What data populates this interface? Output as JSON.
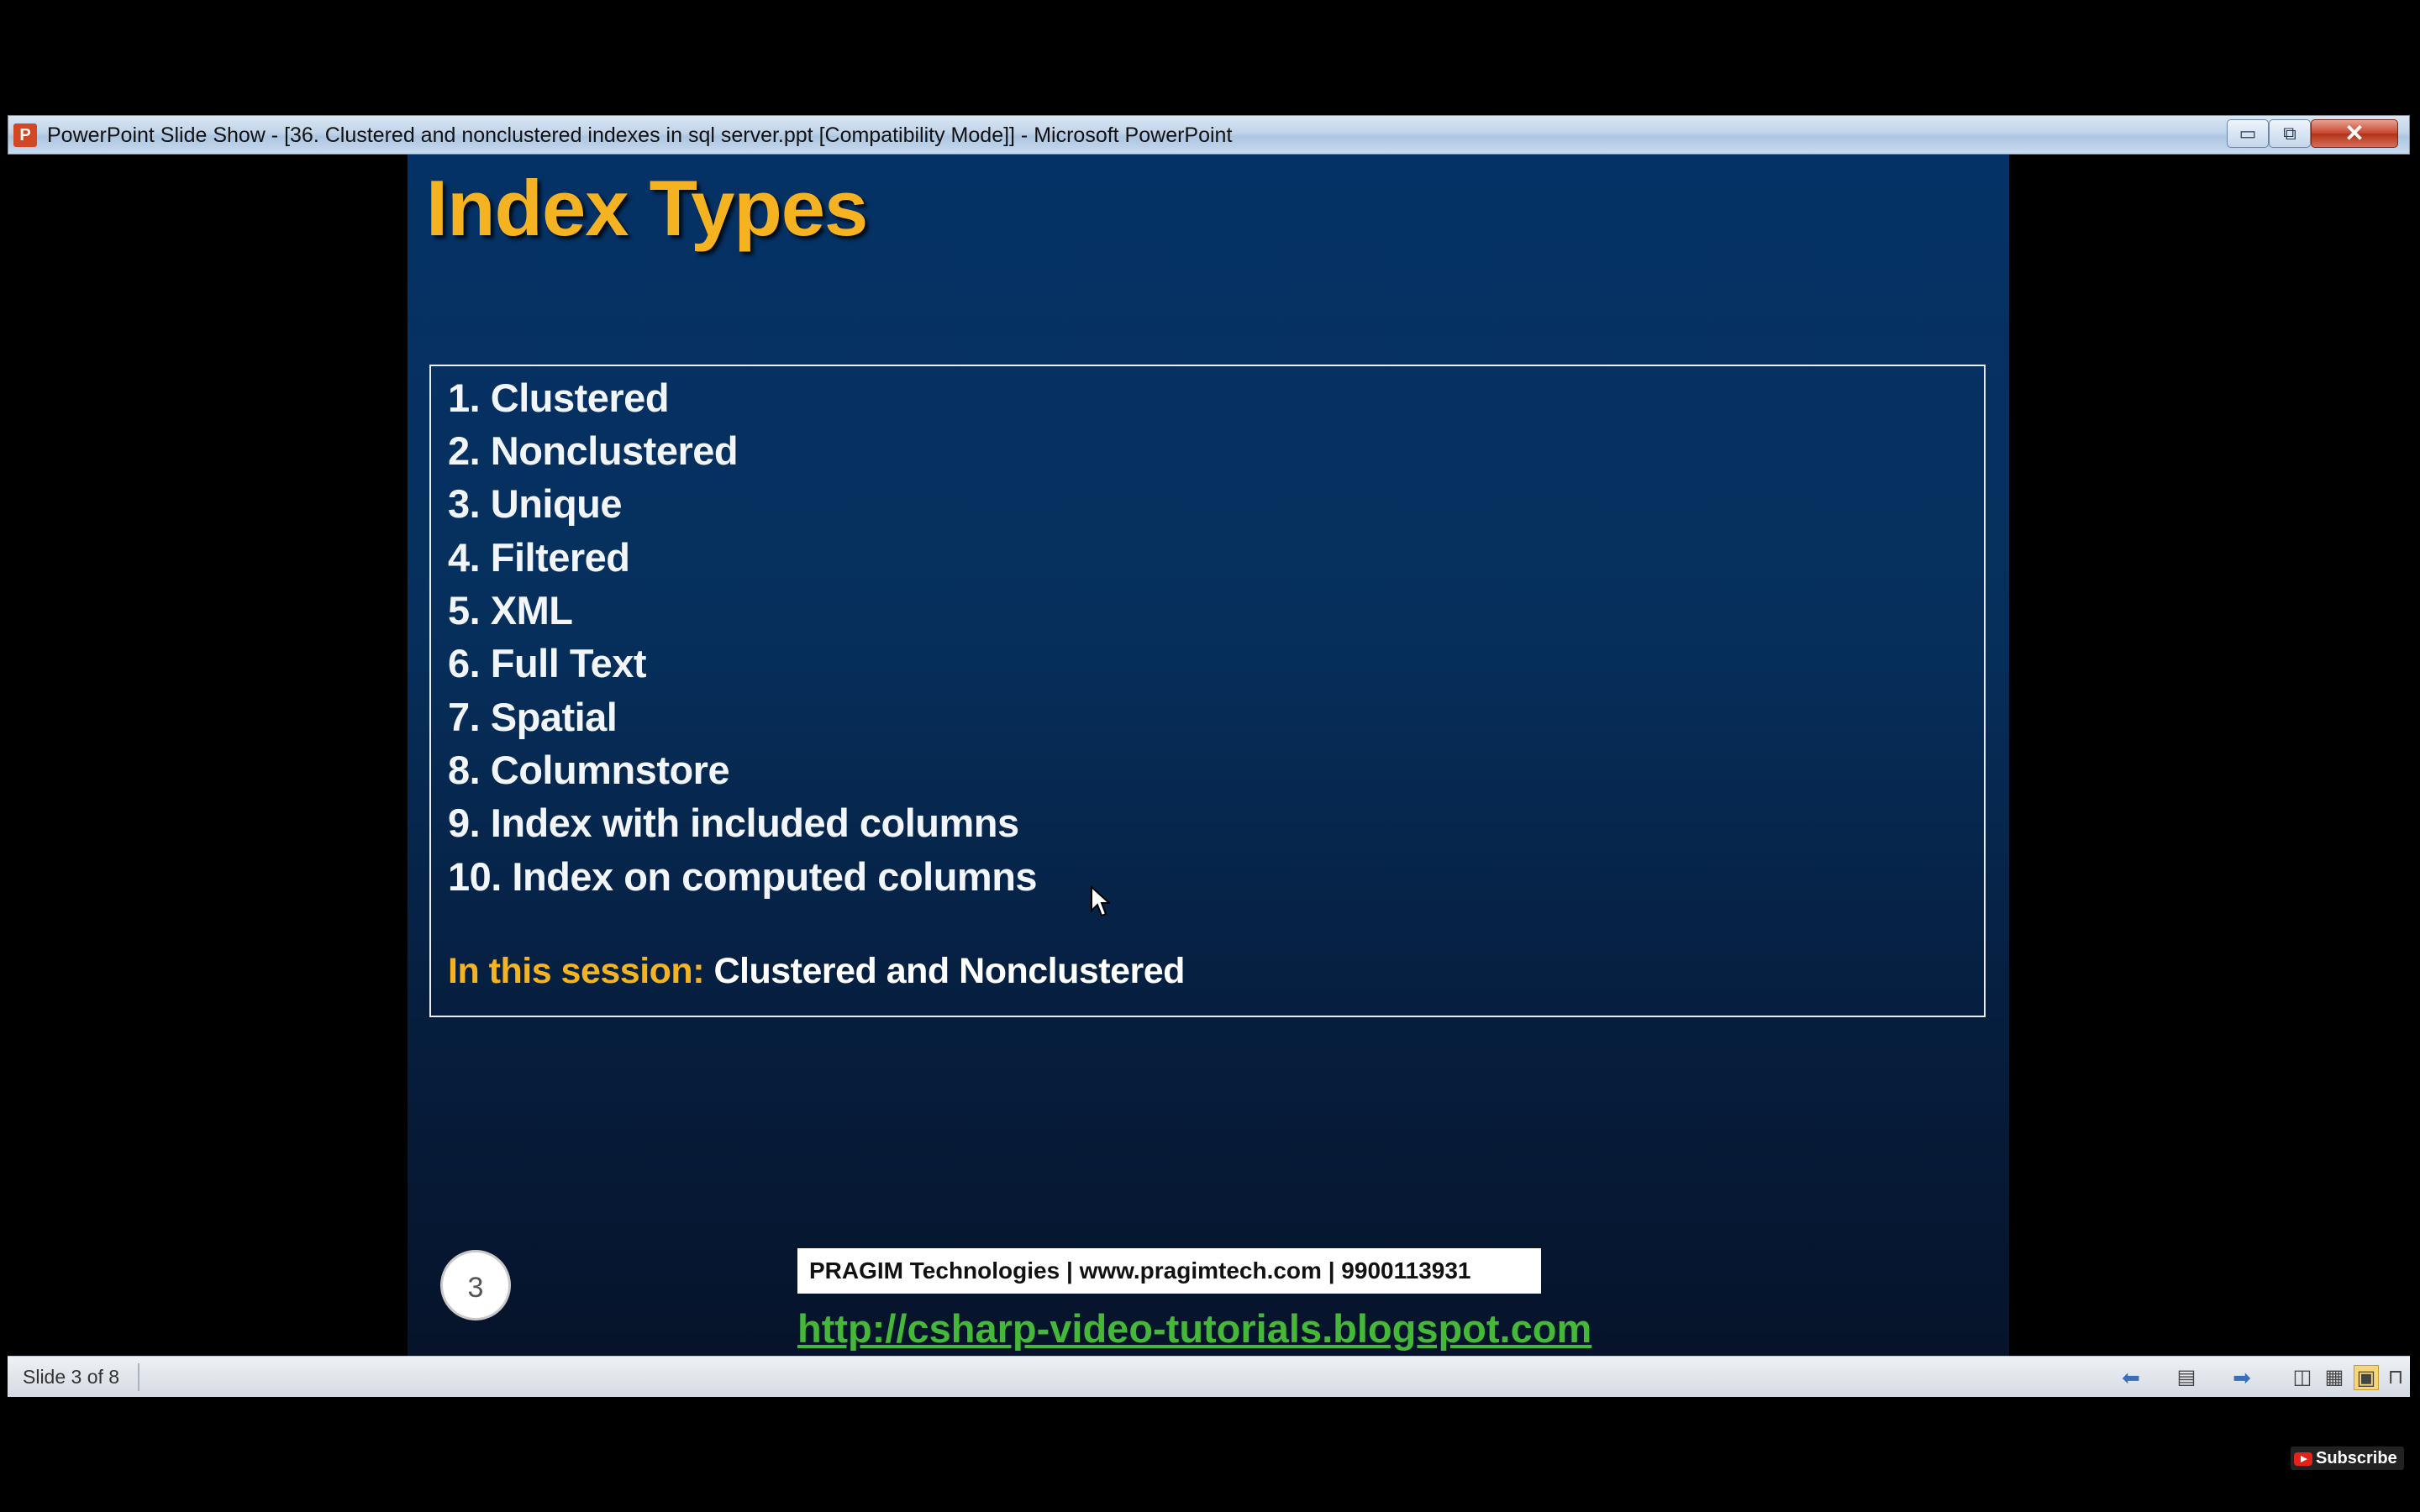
{
  "window": {
    "title": "PowerPoint Slide Show - [36. Clustered and nonclustered indexes in sql server.ppt [Compatibility Mode]] - Microsoft PowerPoint",
    "app_icon_letter": "P",
    "minimize_symbol": "▭",
    "maximize_symbol": "⧉",
    "close_symbol": "✕"
  },
  "slide": {
    "title": "Index Types",
    "items": [
      "1. Clustered",
      "2. Nonclustered",
      "3. Unique",
      "4. Filtered",
      "5. XML",
      "6. Full Text",
      "7. Spatial",
      "8. Columnstore",
      "9. Index with included columns",
      "10. Index on computed columns"
    ],
    "session_label": "In this session:",
    "session_value": "Clustered and Nonclustered",
    "number": "3",
    "footer_bar": "PRAGIM Technologies | www.pragimtech.com | 9900113931",
    "link": "http://csharp-video-tutorials.blogspot.com"
  },
  "statusbar": {
    "slide_indicator": "Slide 3 of 8",
    "icons": [
      "previous-slide-icon",
      "slide-menu-icon",
      "next-slide-icon",
      "normal-view-icon",
      "slide-sorter-icon",
      "reading-view-icon",
      "slide-show-icon"
    ]
  },
  "overlay": {
    "subscribe_label": "Subscribe"
  },
  "colors": {
    "title_yellow": "#f5b321",
    "slide_bg": "#053266",
    "link_green": "#45b83a",
    "close_red": "#c7452d"
  }
}
